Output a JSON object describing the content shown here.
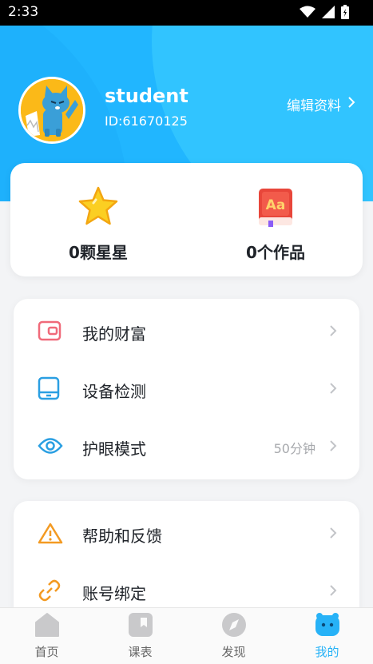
{
  "status_bar": {
    "time": "2:33"
  },
  "profile": {
    "username": "student",
    "user_id": "ID:61670125",
    "edit_label": "编辑资料"
  },
  "stats": [
    {
      "label": "0颗星星",
      "icon": "star-icon"
    },
    {
      "label": "0个作品",
      "icon": "book-icon"
    }
  ],
  "menu_group1": [
    {
      "label": "我的财富",
      "icon": "wallet-icon",
      "value": ""
    },
    {
      "label": "设备检测",
      "icon": "tablet-icon",
      "value": ""
    },
    {
      "label": "护眼模式",
      "icon": "eye-icon",
      "value": "50分钟"
    }
  ],
  "menu_group2": [
    {
      "label": "帮助和反馈",
      "icon": "warning-icon",
      "value": ""
    },
    {
      "label": "账号绑定",
      "icon": "link-icon",
      "value": ""
    }
  ],
  "nav": [
    {
      "label": "首页",
      "icon": "home-icon",
      "active": false
    },
    {
      "label": "课表",
      "icon": "schedule-icon",
      "active": false
    },
    {
      "label": "发现",
      "icon": "compass-icon",
      "active": false
    },
    {
      "label": "我的",
      "icon": "me-icon",
      "active": true
    }
  ],
  "colors": {
    "header_blue": "#21b6ff",
    "active_blue": "#27b2f7",
    "wallet_pink": "#f06a7a",
    "tablet_blue": "#2a9fe2",
    "warning_orange": "#f39a22"
  }
}
